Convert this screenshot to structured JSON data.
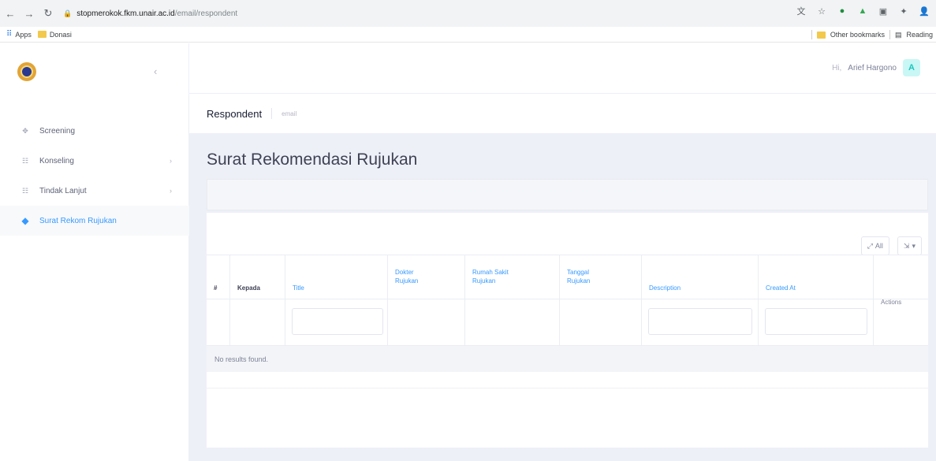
{
  "browser": {
    "url_host": "stopmerokok.fkm.unair.ac.id",
    "url_path": "/email/respondent",
    "bookmarks": [
      {
        "label": "Apps",
        "icon": "apps-grid-icon"
      },
      {
        "label": "Donasi",
        "icon": "folder-icon"
      }
    ],
    "bookmarks_right": [
      "Other bookmarks",
      "Reading"
    ]
  },
  "sidebar": {
    "items": [
      {
        "label": "Screening",
        "icon": "screening-icon",
        "has_arrow": false,
        "active": false
      },
      {
        "label": "Konseling",
        "icon": "konseling-icon",
        "has_arrow": true,
        "active": false
      },
      {
        "label": "Tindak Lanjut",
        "icon": "tindak-lanjut-icon",
        "has_arrow": true,
        "active": false
      },
      {
        "label": "Surat Rekom Rujukan",
        "icon": "diamond-icon",
        "has_arrow": false,
        "active": true
      }
    ]
  },
  "topbar": {
    "greeting": "Hi,",
    "user_name": "Arief Hargono",
    "avatar_letter": "A"
  },
  "subheader": {
    "title": "Respondent",
    "description": "email"
  },
  "page": {
    "title": "Surat Rekomendasi Rujukan"
  },
  "toolbar": {
    "all_label": "All",
    "export_caret": "▾"
  },
  "table": {
    "columns": [
      {
        "label": "#"
      },
      {
        "label": "Kepada"
      },
      {
        "label": "Title"
      },
      {
        "label": "Dokter\nRujukan"
      },
      {
        "label": "Rumah Sakit\nRujukan"
      },
      {
        "label": "Tanggal\nRujukan"
      },
      {
        "label": "Description"
      },
      {
        "label": "Created At"
      },
      {
        "label": "Actions"
      }
    ],
    "empty_text": "No results found."
  },
  "colors": {
    "accent": "#3699ff",
    "page_bg": "#eef0f8",
    "avatar_bg": "#c9f7f5",
    "avatar_fg": "#1bc5bd"
  }
}
